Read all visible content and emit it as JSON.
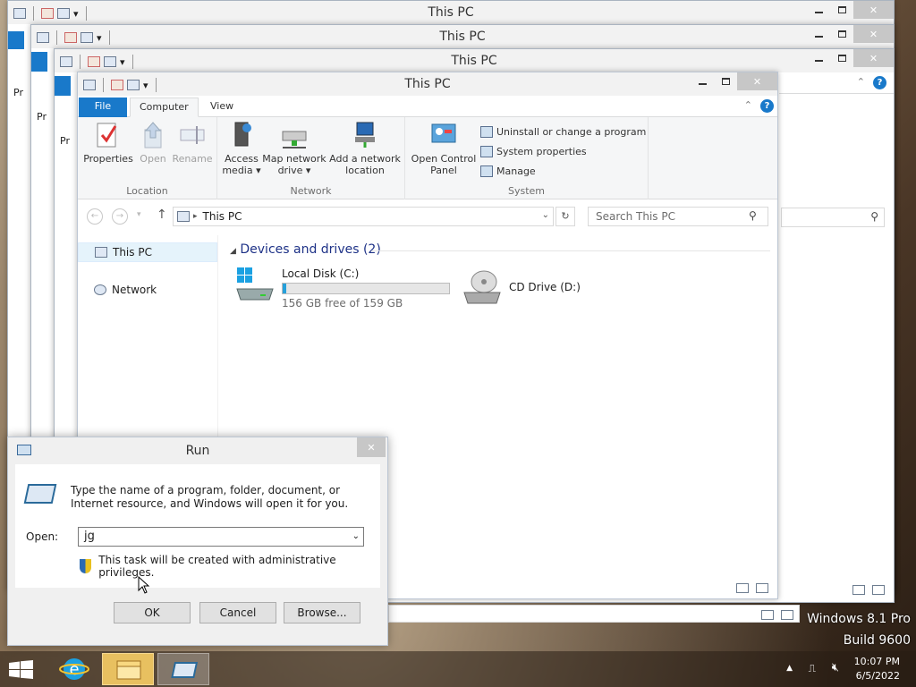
{
  "explorer": {
    "title": "This PC",
    "tabs": {
      "file": "File",
      "computer": "Computer",
      "view": "View"
    },
    "ribbon": {
      "location": {
        "label": "Location",
        "properties": "Properties",
        "open": "Open",
        "rename": "Rename"
      },
      "network": {
        "label": "Network",
        "access_media_1": "Access",
        "access_media_2": "media",
        "map_drive_1": "Map network",
        "map_drive_2": "drive",
        "add_location_1": "Add a network",
        "add_location_2": "location"
      },
      "system": {
        "label": "System",
        "control_panel_1": "Open Control",
        "control_panel_2": "Panel",
        "uninstall": "Uninstall or change a program",
        "sysprops": "System properties",
        "manage": "Manage"
      }
    },
    "address": {
      "crumb": "This PC",
      "search_placeholder": "Search This PC"
    },
    "nav": {
      "this_pc": "This PC",
      "network": "Network"
    },
    "section": {
      "title": "Devices and drives (2)"
    },
    "drives": [
      {
        "name": "Local Disk (C:)",
        "free_text": "156 GB free of 159 GB",
        "used_fraction": 0.02
      },
      {
        "name": "CD Drive (D:)"
      }
    ],
    "bg_stub": "Pr"
  },
  "run": {
    "title": "Run",
    "description": "Type the name of a program, folder, document, or Internet resource, and Windows will open it for you.",
    "open_label": "Open:",
    "input_value": "jg",
    "admin_note": "This task will be created with administrative privileges.",
    "ok": "OK",
    "cancel": "Cancel",
    "browse": "Browse..."
  },
  "desktop": {
    "os_name": "Windows 8.1 Pro",
    "build": "Build 9600"
  },
  "taskbar": {
    "time": "10:07 PM",
    "date": "6/5/2022"
  },
  "colors": {
    "accent": "#1979ca",
    "selection": "#e5f3fb",
    "drive_bar": "#26a0da"
  }
}
